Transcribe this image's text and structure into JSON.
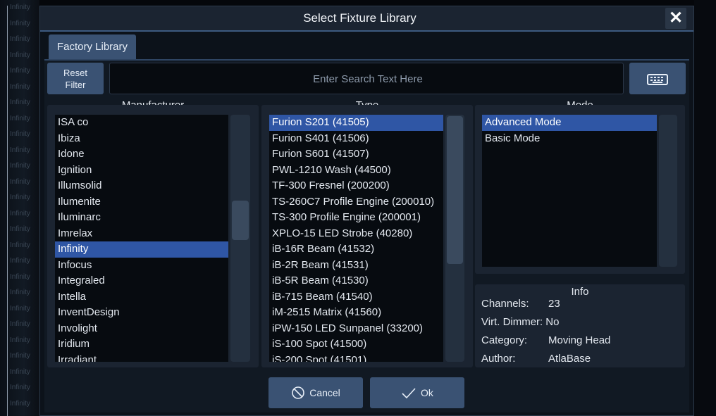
{
  "background": {
    "items": [
      "Infinity",
      "Infinity",
      "Infinity",
      "Infinity",
      "Infinity",
      "Infinity",
      "Infinity",
      "Infinity",
      "Infinity",
      "Infinity",
      "Infinity",
      "Infinity",
      "Infinity",
      "Infinity",
      "Infinity",
      "Infinity",
      "Infinity",
      "Infinity",
      "Infinity",
      "Infinity",
      "Infinity",
      "Infinity",
      "Infinity",
      "Infinity",
      "Infinity",
      "Infinity"
    ]
  },
  "dialog": {
    "title": "Select Fixture Library",
    "close_icon": "close-icon"
  },
  "tabs": [
    {
      "label": "Factory Library"
    }
  ],
  "toolbar": {
    "reset_line1": "Reset",
    "reset_line2": "Filter",
    "search_placeholder": "Enter Search Text Here",
    "keyboard_icon": "keyboard-icon"
  },
  "columns": {
    "manufacturer": "Manufacturer",
    "type": "Type",
    "mode": "Mode"
  },
  "manufacturers": [
    {
      "label": "ISA co",
      "selected": false
    },
    {
      "label": "Ibiza",
      "selected": false
    },
    {
      "label": "Idone",
      "selected": false
    },
    {
      "label": "Ignition",
      "selected": false
    },
    {
      "label": "Illumsolid",
      "selected": false
    },
    {
      "label": "Ilumenite",
      "selected": false
    },
    {
      "label": "Iluminarc",
      "selected": false
    },
    {
      "label": "Imrelax",
      "selected": false
    },
    {
      "label": "Infinity",
      "selected": true
    },
    {
      "label": "Infocus",
      "selected": false
    },
    {
      "label": "Integraled",
      "selected": false
    },
    {
      "label": "Intella",
      "selected": false
    },
    {
      "label": "InventDesign",
      "selected": false
    },
    {
      "label": "Involight",
      "selected": false
    },
    {
      "label": "Iridium",
      "selected": false
    },
    {
      "label": "Irradiant",
      "selected": false
    }
  ],
  "types": [
    {
      "label": "Furion S201 (41505)",
      "selected": true
    },
    {
      "label": "Furion S401 (41506)",
      "selected": false
    },
    {
      "label": "Furion S601 (41507)",
      "selected": false
    },
    {
      "label": "PWL-1210 Wash (44500)",
      "selected": false
    },
    {
      "label": "TF-300 Fresnel (200200)",
      "selected": false
    },
    {
      "label": "TS-260C7 Profile Engine (200010)",
      "selected": false
    },
    {
      "label": "TS-300 Profile Engine (200001)",
      "selected": false
    },
    {
      "label": "XPLO-15 LED Strobe (40280)",
      "selected": false
    },
    {
      "label": "iB-16R Beam (41532)",
      "selected": false
    },
    {
      "label": "iB-2R Beam (41531)",
      "selected": false
    },
    {
      "label": "iB-5R Beam (41530)",
      "selected": false
    },
    {
      "label": "iB-715 Beam (41540)",
      "selected": false
    },
    {
      "label": "iM-2515 Matrix (41560)",
      "selected": false
    },
    {
      "label": "iPW-150 LED Sunpanel (33200)",
      "selected": false
    },
    {
      "label": "iS-100 Spot (41500)",
      "selected": false
    },
    {
      "label": "iS-200 Spot (41501)",
      "selected": false
    }
  ],
  "modes": [
    {
      "label": "Advanced Mode",
      "selected": true
    },
    {
      "label": "Basic Mode",
      "selected": false
    }
  ],
  "info": {
    "title": "Info",
    "channels_label": "Channels:",
    "channels_value": "23",
    "virt_label": "Virt. Dimmer:",
    "virt_value": "No",
    "category_label": "Category:",
    "category_value": "Moving Head",
    "author_label": "Author:",
    "author_value": "AtlaBase"
  },
  "buttons": {
    "cancel": "Cancel",
    "cancel_icon": "cancel-icon",
    "ok": "Ok",
    "ok_icon": "check-icon"
  },
  "colors": {
    "accent": "#3a5273",
    "selection": "#2f56a5",
    "panel": "#1b2431",
    "list_bg": "#070b10"
  }
}
